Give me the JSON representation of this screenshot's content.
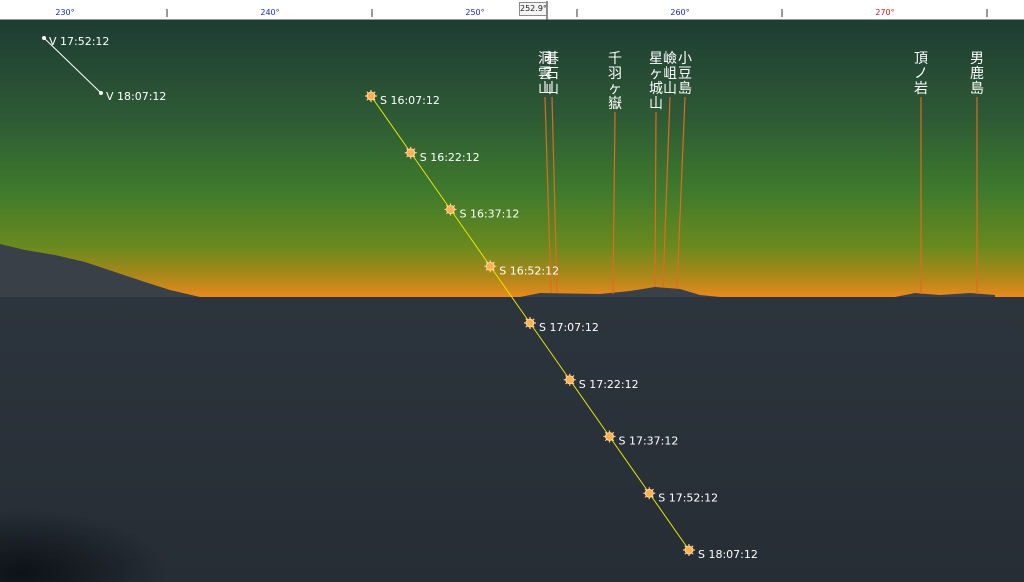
{
  "ruler": {
    "ticks": [
      {
        "label": "230°",
        "color": "#1a2fa8"
      },
      {
        "label": "240°",
        "color": "#1a2fa8"
      },
      {
        "label": "250°",
        "color": "#1a2fa8"
      },
      {
        "label": "260°",
        "color": "#1a2fa8"
      },
      {
        "label": "270°",
        "color": "#c41e1e"
      }
    ],
    "cursor_azimuth": "252.9°"
  },
  "venus_track": [
    {
      "label": "V 17:52:12"
    },
    {
      "label": "V 18:07:12"
    }
  ],
  "sun_track": [
    {
      "label": "S 16:07:12"
    },
    {
      "label": "S 16:22:12"
    },
    {
      "label": "S 16:37:12"
    },
    {
      "label": "S 16:52:12"
    },
    {
      "label": "S 17:07:12"
    },
    {
      "label": "S 17:22:12"
    },
    {
      "label": "S 17:37:12"
    },
    {
      "label": "S 17:52:12"
    },
    {
      "label": "S 18:07:12"
    }
  ],
  "peaks": [
    {
      "name": "洞雲山"
    },
    {
      "name": "碁石山"
    },
    {
      "name": "千羽ヶ嶽"
    },
    {
      "name": "星ヶ城山"
    },
    {
      "name": "嶮岨山"
    },
    {
      "name": "小豆島"
    },
    {
      "name": "頂ノ岩"
    },
    {
      "name": "男鹿島"
    }
  ],
  "colors": {
    "sky_top": "#1f3f34",
    "sky_mid": "#3c6e2e",
    "sky_horizon": "#e88a1e",
    "sea": "#2a323b",
    "sun_track": "#e6e600",
    "sun_marker": "#ffb050",
    "venus_track": "#ffffff",
    "peak_line": "#e06a22"
  }
}
